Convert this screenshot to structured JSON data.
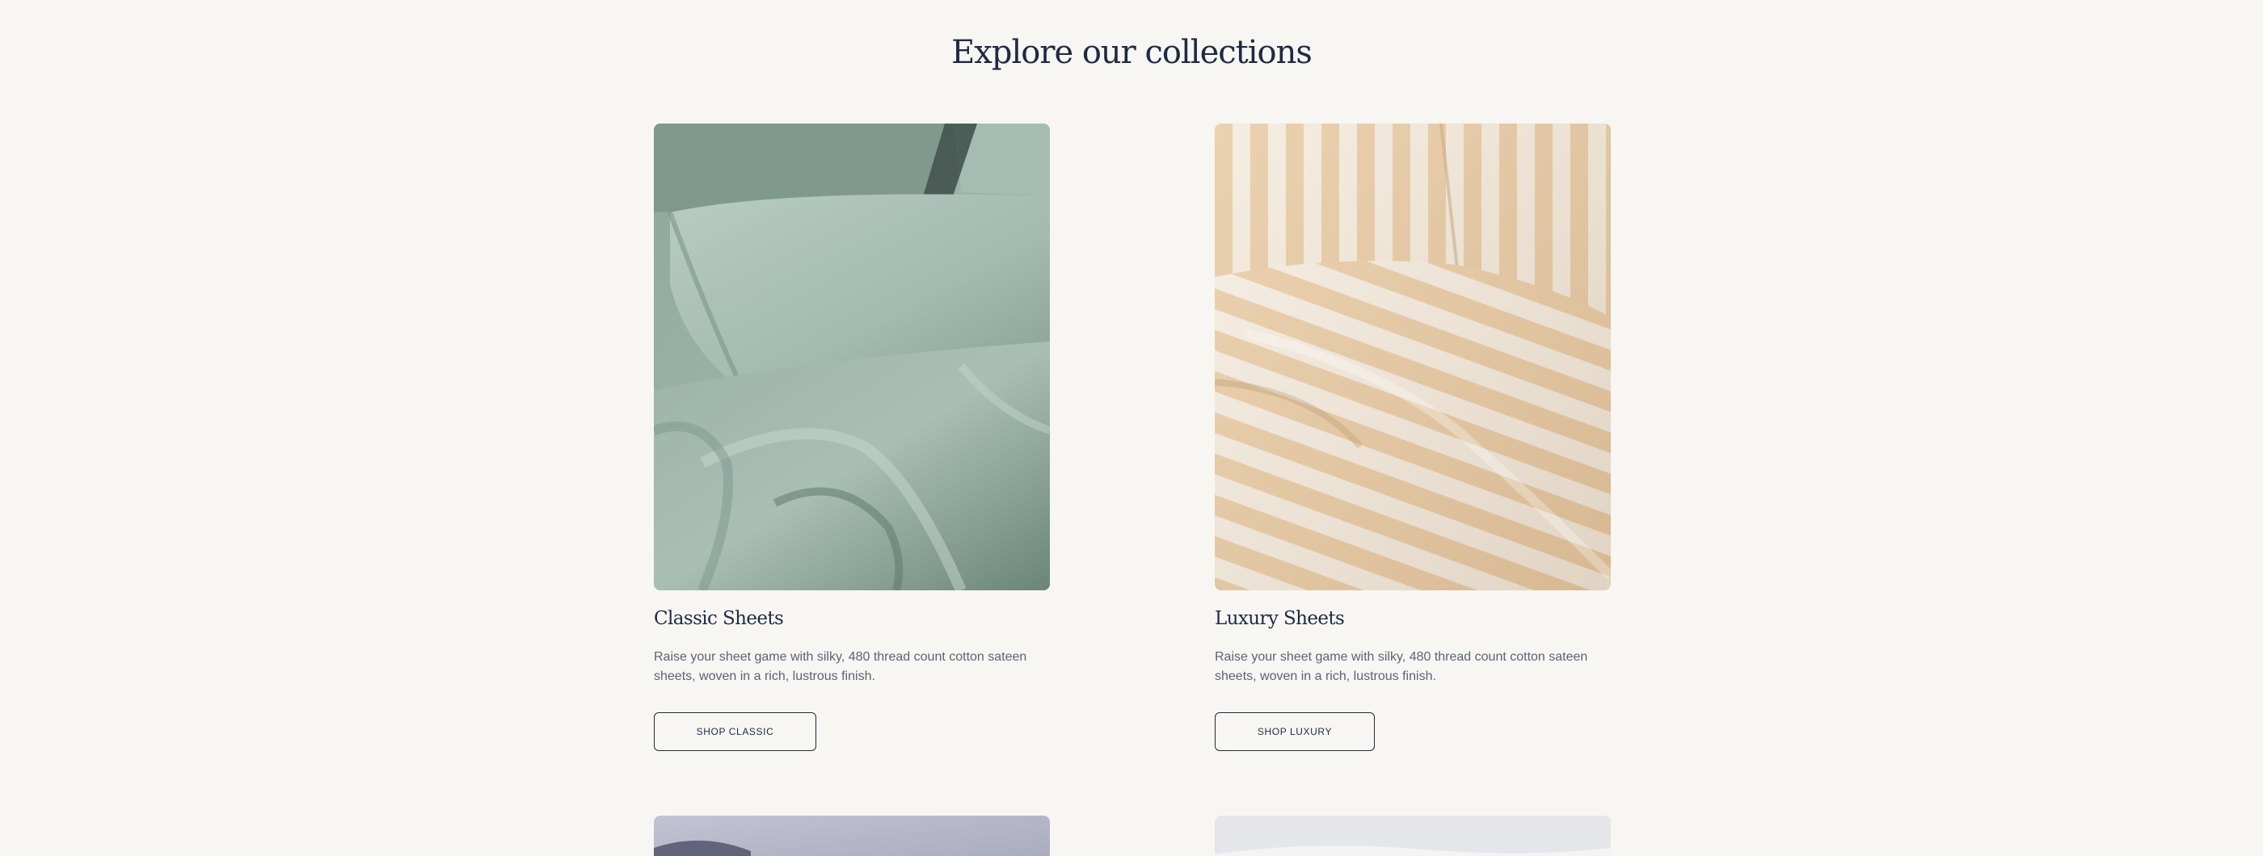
{
  "section": {
    "title": "Explore our collections"
  },
  "collections": [
    {
      "title": "Classic Sheets",
      "description": "Raise your sheet game with silky, 480 thread count cotton sateen sheets, woven in a rich, lustrous finish.",
      "button_label": "SHOP CLASSIC",
      "image": "sage-green-bedding-photo",
      "color": "#94ada2"
    },
    {
      "title": "Luxury Sheets",
      "description": "Raise your sheet game with silky, 480 thread count cotton sateen sheets, woven in a rich, lustrous finish.",
      "button_label": "SHOP LUXURY",
      "image": "tan-stripe-bedding-photo",
      "color": "#e6c7a0"
    },
    {
      "image": "lavender-bedding-photo",
      "color": "#b7b8cb"
    },
    {
      "image": "white-bedding-photo",
      "color": "#e4e6ea"
    }
  ],
  "colors": {
    "background": "#f7f6f2",
    "heading": "#1e2a44",
    "body_text": "#5b6374"
  }
}
